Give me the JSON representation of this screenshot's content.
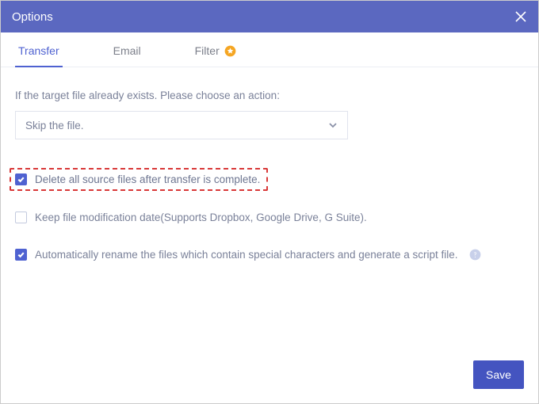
{
  "header": {
    "title": "Options"
  },
  "tabs": {
    "transfer": "Transfer",
    "email": "Email",
    "filter": "Filter"
  },
  "content": {
    "instruction": "If the target file already exists. Please choose an action:",
    "selected_action": "Skip the file.",
    "opt_delete_source": "Delete all source files after transfer is complete.",
    "opt_keep_mtime": "Keep file modification date(Supports Dropbox, Google Drive, G Suite).",
    "opt_auto_rename": "Automatically rename the files which contain special characters and generate a script file."
  },
  "buttons": {
    "save": "Save"
  },
  "state": {
    "delete_source_checked": true,
    "keep_mtime_checked": false,
    "auto_rename_checked": true
  }
}
